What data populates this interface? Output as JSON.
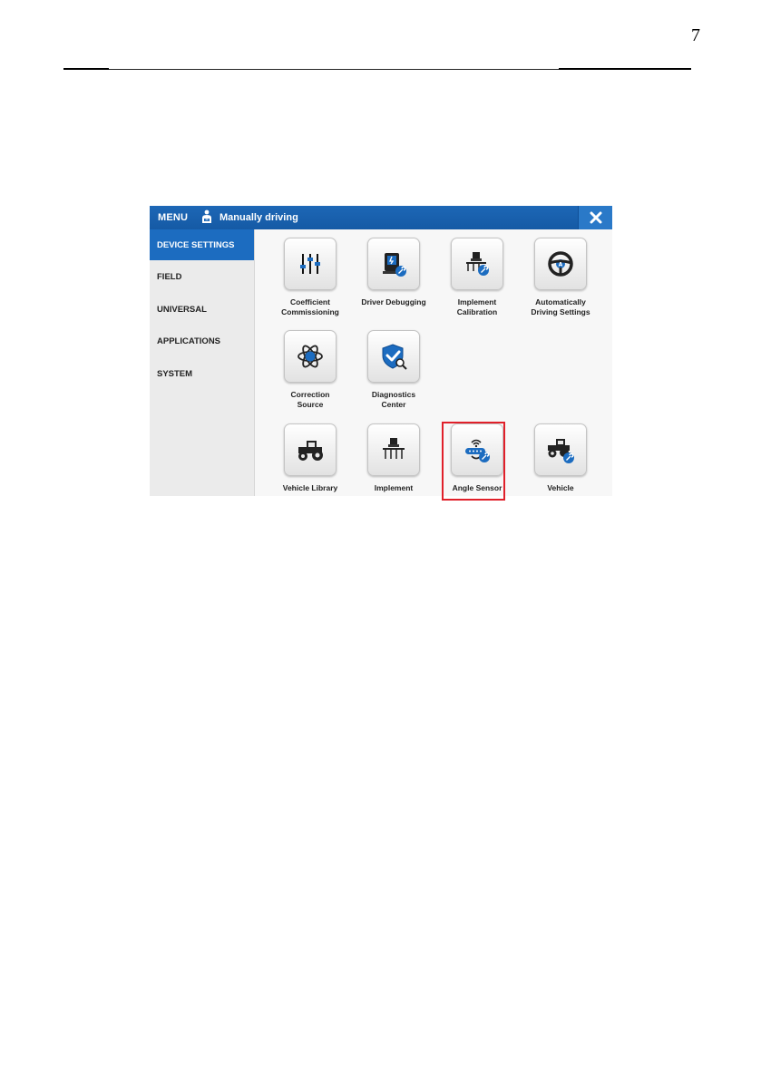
{
  "page": {
    "number": "7"
  },
  "titlebar": {
    "menu_label": "MENU",
    "status_text": "Manually driving"
  },
  "sidebar": {
    "items": [
      {
        "label": "DEVICE SETTINGS",
        "active": true
      },
      {
        "label": "FIELD"
      },
      {
        "label": "UNIVERSAL"
      },
      {
        "label": "APPLICATIONS"
      },
      {
        "label": "SYSTEM"
      }
    ]
  },
  "tiles": [
    {
      "line1": "Coefficient",
      "line2": "Commissioning",
      "icon": "sliders-icon"
    },
    {
      "line1": "Driver Debugging",
      "line2": "",
      "icon": "driver-debugging-icon"
    },
    {
      "line1": "Implement",
      "line2": "Calibration",
      "icon": "implement-calibration-icon"
    },
    {
      "line1": "Automatically",
      "line2": "Driving Settings",
      "icon": "steering-wheel-icon"
    },
    {
      "line1": "Correction",
      "line2": "Source",
      "icon": "atom-icon"
    },
    {
      "line1": "Diagnostics",
      "line2": "Center",
      "icon": "shield-check-icon"
    },
    {
      "line1": "Vehicle Library",
      "line2": "",
      "icon": "tractor-icon"
    },
    {
      "line1": "Implement",
      "line2": "",
      "icon": "implement-icon"
    },
    {
      "line1": "Angle Sensor",
      "line2": "",
      "icon": "angle-sensor-icon",
      "highlighted": true
    },
    {
      "line1": "Vehicle",
      "line2": "",
      "icon": "vehicle-settings-icon"
    }
  ],
  "colors": {
    "accent": "#1c6cc0",
    "highlight": "#e0202a"
  }
}
